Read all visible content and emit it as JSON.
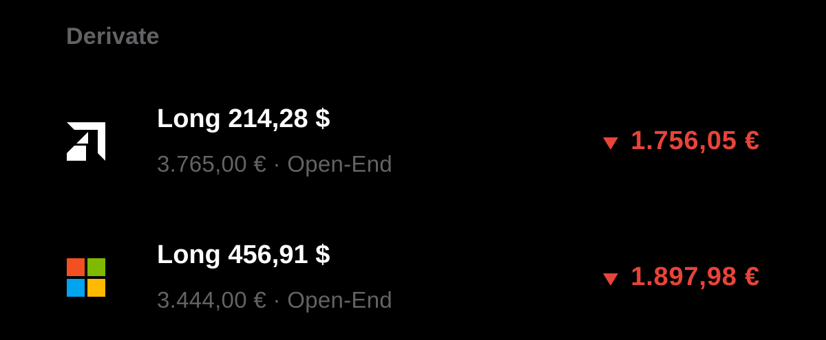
{
  "section": {
    "title": "Derivate"
  },
  "items": [
    {
      "logo_icon": "amd-logo-icon",
      "name": "Long 214,28 $",
      "subtitle": "3.765,00 € · Open-End",
      "change": "1.756,05 €",
      "change_direction": "down",
      "change_color": "#e8443a"
    },
    {
      "logo_icon": "microsoft-logo-icon",
      "name": "Long 456,91 $",
      "subtitle": "3.444,00 € · Open-End",
      "change": "1.897,98 €",
      "change_direction": "down",
      "change_color": "#e8443a"
    }
  ],
  "colors": {
    "background": "#000000",
    "title_gray": "#636366",
    "negative_red": "#e8443a",
    "ms_red": "#f25022",
    "ms_green": "#7fba00",
    "ms_blue": "#00a4ef",
    "ms_yellow": "#ffb900"
  }
}
